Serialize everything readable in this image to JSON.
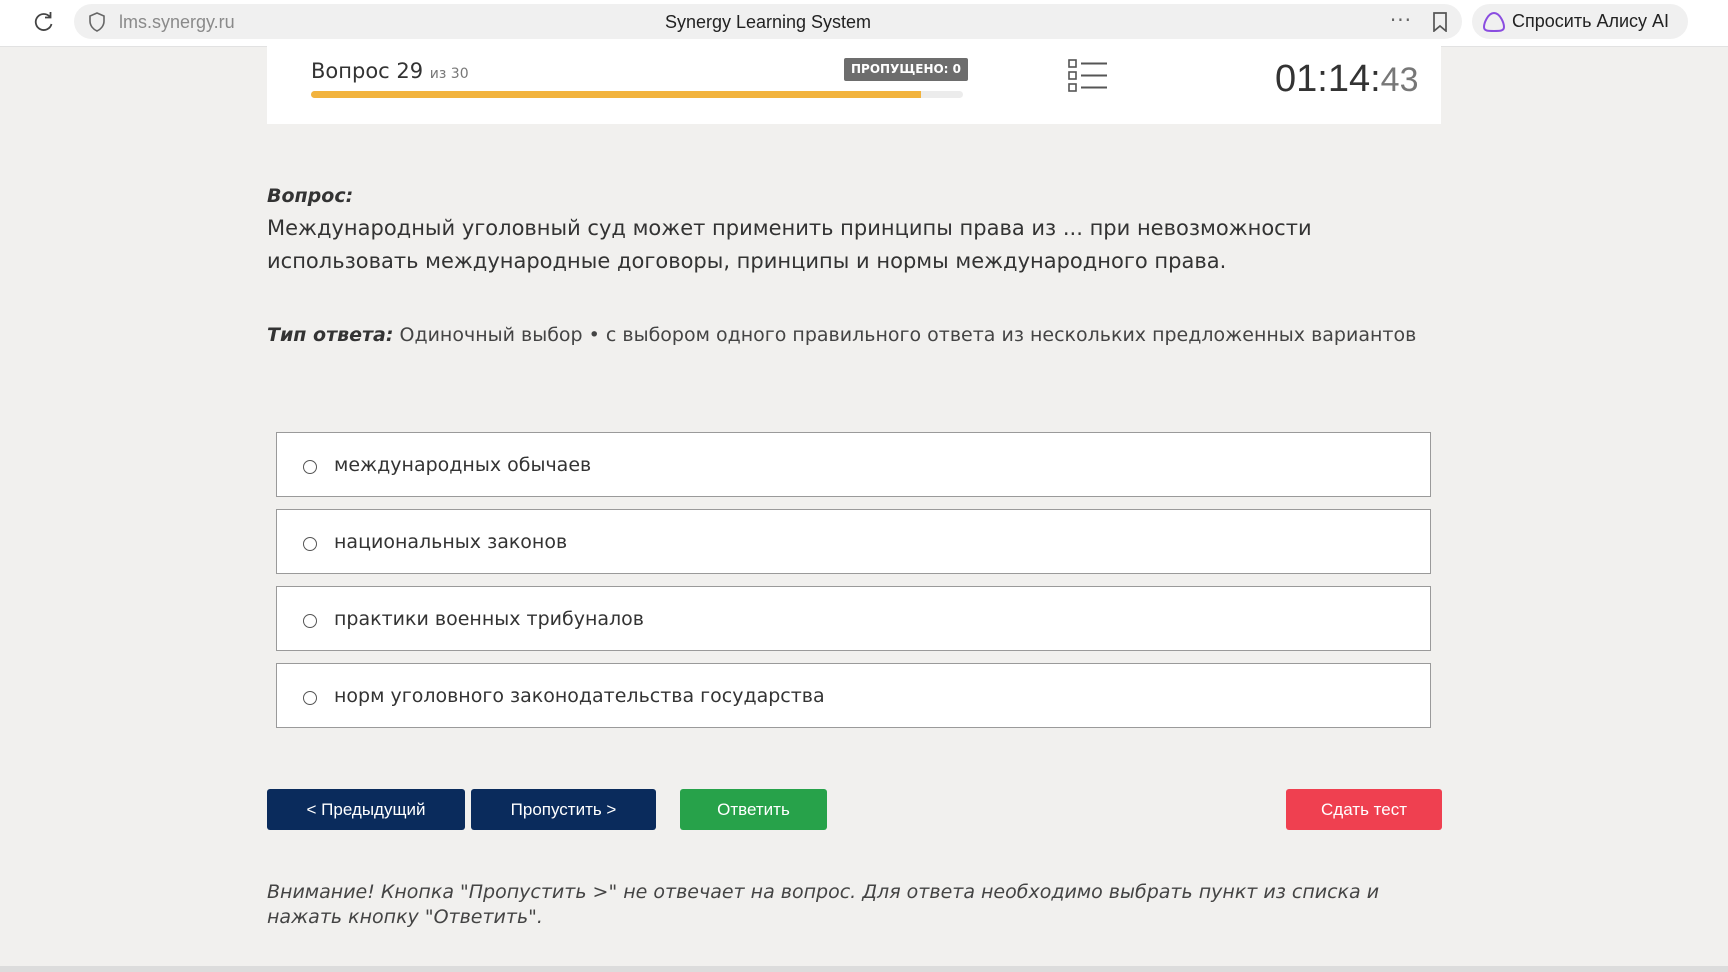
{
  "browser": {
    "url": "lms.synergy.ru",
    "page_title": "Synergy Learning System",
    "alice_label": "Спросить Алису AI"
  },
  "header": {
    "question_label": "Вопрос 29",
    "question_of": "из 30",
    "skipped_badge": "ПРОПУЩЕНО: 0",
    "progress_fraction": 0.935,
    "timer_main": "01:14:",
    "timer_seconds": "43"
  },
  "question": {
    "label": "Вопрос:",
    "text": "Международный уголовный суд может применить принципы права из ... при невозможности использовать международные договоры, принципы и нормы международного права.",
    "answer_type_label": "Тип ответа:",
    "answer_type_value": "Одиночный выбор • с выбором одного правильного ответа из нескольких предложенных вариантов"
  },
  "options": [
    "международных обычаев",
    "национальных законов",
    "практики военных трибуналов",
    "норм уголовного законодательства государства"
  ],
  "buttons": {
    "prev": "< Предыдущий",
    "skip": "Пропустить >",
    "answer": "Ответить",
    "submit": "Сдать тест"
  },
  "notice": "Внимание! Кнопка \"Пропустить >\" не отвечает на вопрос. Для ответа необходимо выбрать пункт из списка и нажать кнопку \"Ответить\".",
  "colors": {
    "nav_button": "#0a2b5c",
    "answer_button": "#27a24a",
    "submit_button": "#ef4050",
    "progress": "#f2b33d"
  }
}
